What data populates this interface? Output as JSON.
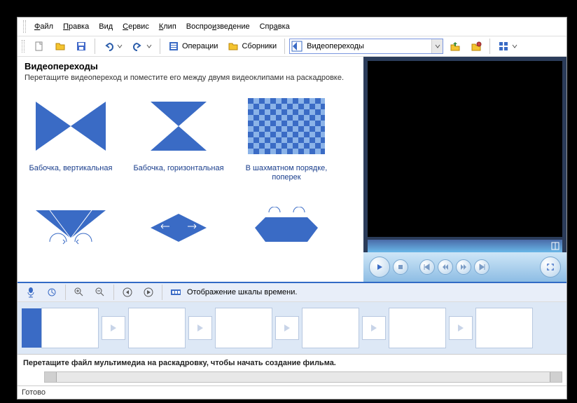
{
  "menu": {
    "file": "Файл",
    "edit": "Правка",
    "view": "Вид",
    "service": "Сервис",
    "clip": "Клип",
    "play": "Воспроизведение",
    "help": "Справка"
  },
  "toolbar": {
    "operations": "Операции",
    "collections": "Сборники",
    "combo": "Видеопереходы"
  },
  "content": {
    "title": "Видеопереходы",
    "subtitle": "Перетащите видеопереход и поместите его между двумя видеоклипами на раскадровке."
  },
  "items": [
    {
      "label": "Бабочка, вертикальная"
    },
    {
      "label": "Бабочка, горизонтальная"
    },
    {
      "label": "В шахматном порядке, поперек"
    },
    {
      "label": ""
    },
    {
      "label": ""
    },
    {
      "label": ""
    }
  ],
  "timeline": {
    "label": "Отображение шкалы времени.",
    "hint": "Перетащите файл мультимедиа на раскадровку, чтобы начать создание фильма."
  },
  "status": "Готово"
}
